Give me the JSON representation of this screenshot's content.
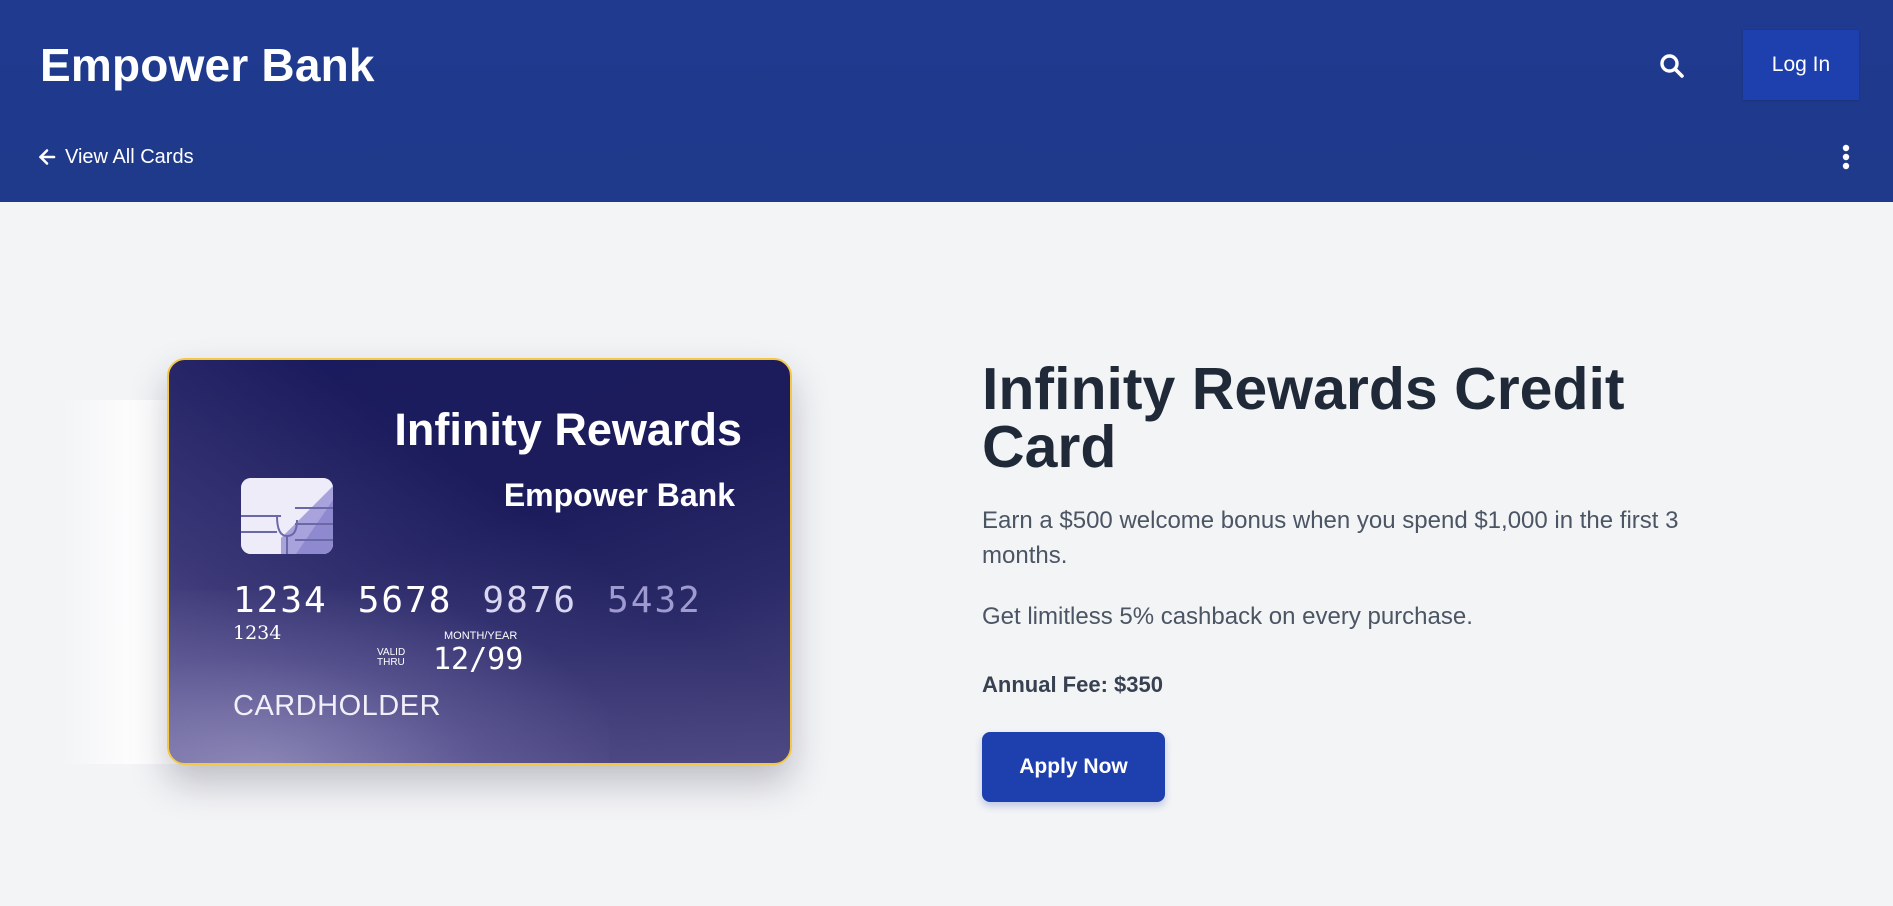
{
  "header": {
    "brand": "Empower Bank",
    "login_label": "Log In",
    "back_label": "View All Cards"
  },
  "card_visual": {
    "name": "Infinity Rewards",
    "bank": "Empower Bank",
    "number_groups": [
      "1234",
      "5678",
      "9876",
      "5432"
    ],
    "small_number": "1234",
    "valid_thru_label": "VALID THRU",
    "month_year_label": "MONTH/YEAR",
    "expiry": "12/99",
    "cardholder": "CARDHOLDER"
  },
  "product": {
    "title": "Infinity Rewards Credit Card",
    "description_1": "Earn a $500 welcome bonus when you spend $1,000 in the first 3 months.",
    "description_2": "Get limitless 5% cashback on every purchase.",
    "annual_fee": "Annual Fee: $350",
    "apply_label": "Apply Now"
  },
  "icons": {
    "search": "search-icon",
    "back": "arrow-left-icon",
    "more": "more-vertical-icon"
  },
  "colors": {
    "header_bg": "#1f3a8a",
    "button_bg": "#1e40af",
    "page_bg": "#f3f4f6",
    "card_border": "#f5c842"
  }
}
